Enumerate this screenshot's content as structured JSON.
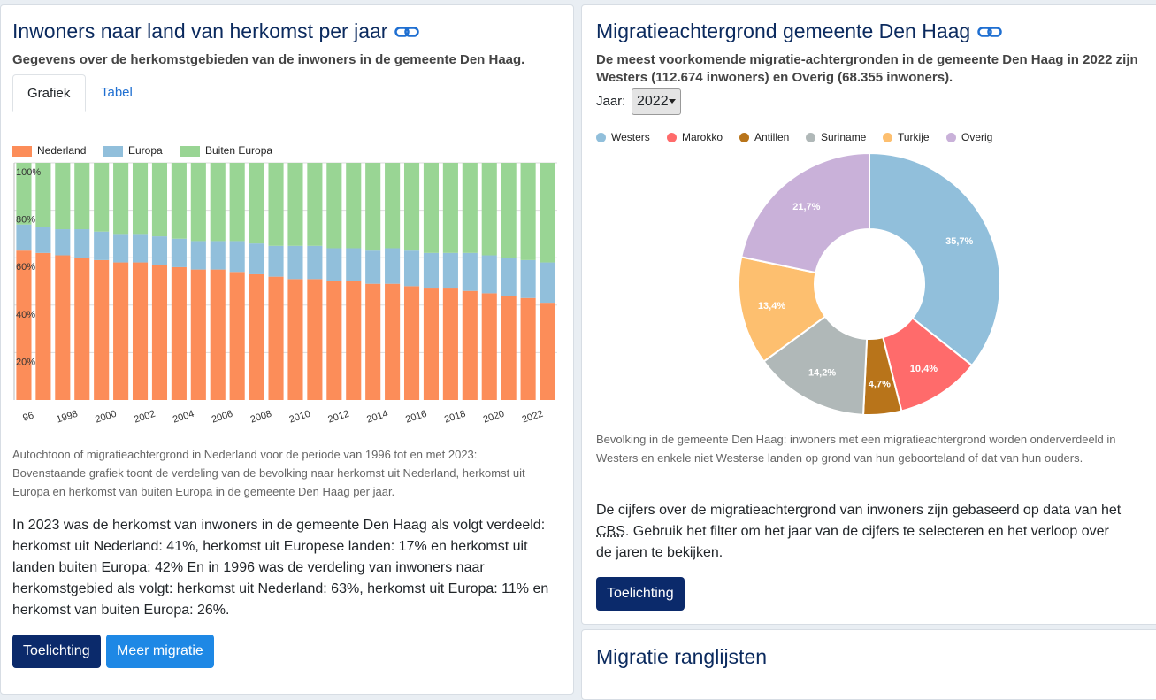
{
  "left": {
    "title": "Inwoners naar land van herkomst per jaar",
    "subtitle": "Gegevens over de herkomstgebieden van de inwoners in de gemeente Den Haag.",
    "tabs": [
      "Grafiek",
      "Tabel"
    ],
    "legend": [
      {
        "label": "Nederland",
        "color": "#fc8d59"
      },
      {
        "label": "Europa",
        "color": "#91bfdb"
      },
      {
        "label": "Buiten Europa",
        "color": "#99d594"
      }
    ],
    "note": "Autochtoon of migratieachtergrond in Nederland voor de periode van 1996 tot en met 2023: Bovenstaande grafiek toont de verdeling van de bevolking naar herkomst uit Nederland, herkomst uit Europa en herkomst van buiten Europa in de gemeente Den Haag per jaar.",
    "body": "In 2023 was de herkomst van inwoners in de gemeente Den Haag als volgt verdeeld: herkomst uit Nederland: 41%, herkomst uit Europese landen: 17% en herkomst uit landen buiten Europa: 42% En in 1996 was de verdeling van inwoners naar herkomstgebied als volgt: herkomst uit Nederland: 63%, herkomst uit Europa: 11% en herkomst van buiten Europa: 26%.",
    "buttons": {
      "toelichting": "Toelichting",
      "meer": "Meer migratie"
    }
  },
  "right": {
    "title": "Migratieachtergrond gemeente Den Haag",
    "subtitle": "De meest voorkomende migratie-achtergronden in de gemeente Den Haag in 2022 zijn Westers (112.674 inwoners) en Overig (68.355 inwoners).",
    "year_label": "Jaar:",
    "year_value": "2022",
    "note": "Bevolking in de gemeente Den Haag: inwoners met een migratieachtergrond worden onderverdeeld in Westers en enkele niet Westerse landen op grond van hun geboorteland of dat van hun ouders.",
    "body_before": "De cijfers over de migratieachtergrond van inwoners zijn gebaseerd op data van het ",
    "body_abbr": "CBS",
    "body_after": ". Gebruik het filter om het jaar van de cijfers te selecteren en het verloop over de jaren te bekijken.",
    "button": "Toelichting"
  },
  "ranking": {
    "title": "Migratie ranglijsten"
  },
  "chart_data": [
    {
      "type": "bar",
      "stacked": true,
      "normalized": true,
      "categories": [
        1996,
        1997,
        1998,
        1999,
        2000,
        2001,
        2002,
        2003,
        2004,
        2005,
        2006,
        2007,
        2008,
        2009,
        2010,
        2011,
        2012,
        2013,
        2014,
        2015,
        2016,
        2017,
        2018,
        2019,
        2020,
        2021,
        2022,
        2023
      ],
      "tick_labels": [
        "96",
        "1998",
        "2000",
        "2002",
        "2004",
        "2006",
        "2008",
        "2010",
        "2012",
        "2014",
        "2016",
        "2018",
        "2020",
        "2022"
      ],
      "y_ticks": [
        "20%",
        "40%",
        "60%",
        "80%",
        "100%"
      ],
      "ylim": [
        0,
        100
      ],
      "series": [
        {
          "name": "Nederland",
          "color": "#fc8d59",
          "values": [
            63,
            62,
            61,
            60,
            59,
            58,
            58,
            57,
            56,
            55,
            55,
            54,
            53,
            52,
            51,
            51,
            50,
            50,
            49,
            49,
            48,
            47,
            47,
            46,
            45,
            44,
            43,
            41
          ]
        },
        {
          "name": "Europa",
          "color": "#91bfdb",
          "values": [
            11,
            11,
            11,
            12,
            12,
            12,
            12,
            12,
            12,
            12,
            12,
            13,
            13,
            13,
            14,
            14,
            14,
            14,
            14,
            15,
            15,
            15,
            15,
            16,
            16,
            16,
            16,
            17
          ]
        },
        {
          "name": "Buiten Europa",
          "color": "#99d594",
          "values": [
            26,
            27,
            28,
            28,
            29,
            30,
            30,
            31,
            32,
            33,
            33,
            33,
            34,
            35,
            35,
            35,
            36,
            36,
            37,
            36,
            37,
            38,
            38,
            38,
            39,
            40,
            41,
            42
          ]
        }
      ]
    },
    {
      "type": "pie",
      "donut": true,
      "slices": [
        {
          "label": "Westers",
          "value": 35.7,
          "display": "35,7%",
          "color": "#91bfdb"
        },
        {
          "label": "Marokko",
          "value": 10.4,
          "display": "10,4%",
          "color": "#ff6b6b"
        },
        {
          "label": "Antillen",
          "value": 4.7,
          "display": "4,7%",
          "color": "#b8741a"
        },
        {
          "label": "Suriname",
          "value": 14.2,
          "display": "14,2%",
          "color": "#b0b8b8"
        },
        {
          "label": "Turkije",
          "value": 13.4,
          "display": "13,4%",
          "color": "#fdbf6f"
        },
        {
          "label": "Overig",
          "value": 21.7,
          "display": "21,7%",
          "color": "#c9b1d9"
        }
      ]
    }
  ]
}
